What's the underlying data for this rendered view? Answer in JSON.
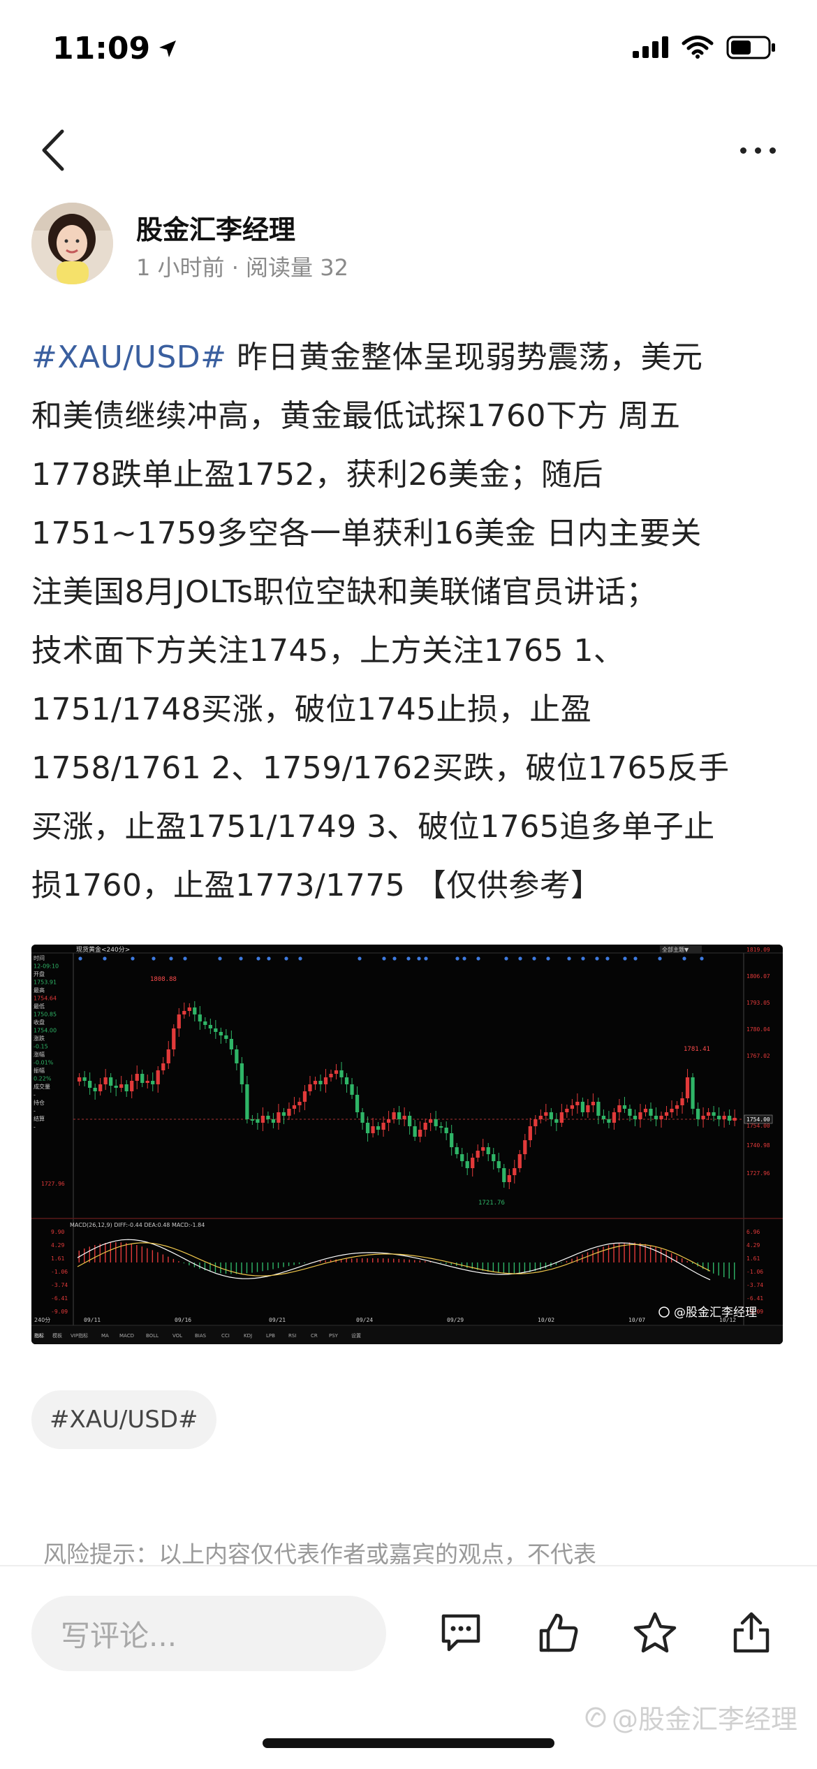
{
  "status": {
    "time": "11:09"
  },
  "author": {
    "name": "股金汇李经理",
    "meta": "1 小时前 · 阅读量 32"
  },
  "post": {
    "hashtag": "#XAU/USD#",
    "lines": [
      " 昨日黄金整体呈现弱势震荡，美元",
      "和美债继续冲高，黄金最低试探1760下方 周五",
      "1778跌单止盈1752，获利26美金；随后",
      "1751~1759多空各一单获利16美金 日内主要关",
      "注美国8月JOLTs职位空缺和美联储官员讲话；",
      "技术面下方关注1745，上方关注1765 1、",
      "1751/1748买涨，破位1745止损，止盈",
      "1758/1761 2、1759/1762买跌，破位1765反手",
      "买涨，止盈1751/1749 3、破位1765追多单子止",
      "损1760，止盈1773/1775 【仅供参考】"
    ]
  },
  "chart": {
    "header_title": "现货黄金<240分>",
    "header_right": "全部主题▼",
    "info_panel": [
      "时间",
      "12-09:10",
      "开盘",
      "1753.91",
      "最高",
      "1754.64",
      "最低",
      "1750.85",
      "收盘",
      "1754.00",
      "涨跌",
      "-0.15",
      "涨幅",
      "-0.01%",
      "振幅",
      "0.22%",
      "成交量",
      "-",
      "持仓",
      "-",
      "结算",
      "-"
    ],
    "price_axis": [
      "1819.09",
      "1806.07",
      "1793.05",
      "1780.04",
      "1767.02",
      "1754.00",
      "1740.98",
      "1727.96"
    ],
    "price_low_label": "1727.96",
    "current_price": "1754.00",
    "high_label": "1808.88",
    "low_label": "1721.76",
    "right_high_label": "1781.41",
    "macd_header": "MACD(26,12,9) DIFF:-0.44  DEA:0.48  MACD:-1.84",
    "macd_axis": [
      "9.90",
      "4.29",
      "1.61",
      "-1.06",
      "-3.74",
      "-6.41",
      "-9.09"
    ],
    "macd_right_axis": [
      "6.96",
      "4.29",
      "1.61",
      "-1.06",
      "-3.74",
      "-6.41",
      "-9.09"
    ],
    "date_labels": [
      "09/11",
      "09/16",
      "09/21",
      "09/24",
      "09/29",
      "10/02",
      "10/07",
      "10/12"
    ],
    "timeframe": "240分",
    "toolbar_tabs": [
      "指标",
      "模板",
      "VIP指标",
      "MA",
      "MACD",
      "BOLL",
      "VOL",
      "BIAS",
      "CCI",
      "KDJ",
      "LPB",
      "RSI",
      "CR",
      "PSY",
      "设置"
    ],
    "watermark": "@股金汇李经理",
    "colors": {
      "up": "#e23a3a",
      "down": "#2fb567",
      "bg": "#050505",
      "diff": "#ffffff",
      "dea": "#f2c94c",
      "marker": "#3e7be0"
    }
  },
  "hashtag_chip": "#XAU/USD#",
  "risk_note": "风险提示：以上内容仅代表作者或嘉宾的观点，不代表",
  "bottom": {
    "comment_placeholder": "写评论...",
    "watermark": "@股金汇李经理"
  }
}
